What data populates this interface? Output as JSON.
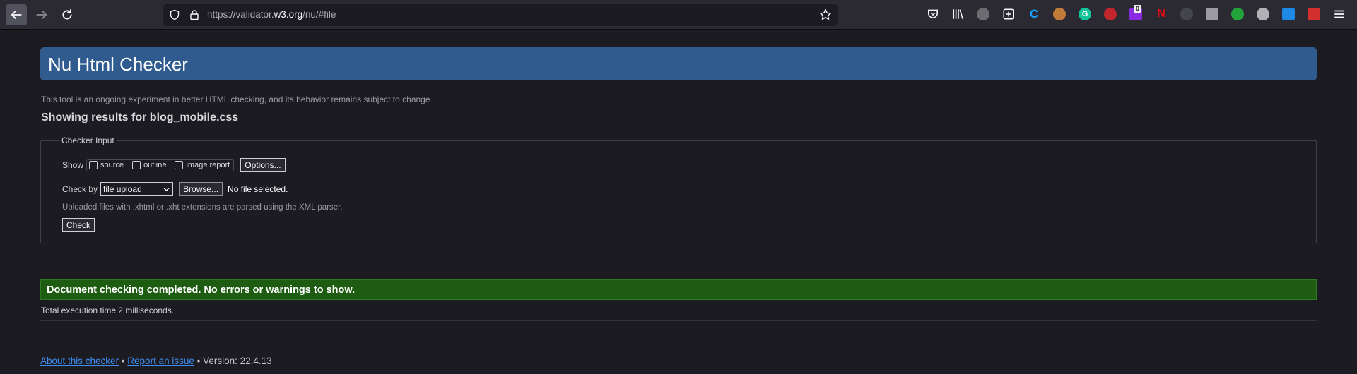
{
  "browser": {
    "url_prefix": "https://validator.",
    "url_host": "w3.org",
    "url_suffix": "/nu/#file",
    "icons": [
      "back-icon",
      "forward-icon",
      "reload-icon",
      "shield-icon",
      "lock-icon",
      "star-icon"
    ],
    "extensions": [
      "pocket-icon",
      "library-icon",
      "extension-icon",
      "extension-icon",
      "extension-icon",
      "extension-icon",
      "grammarly-icon",
      "extension-icon",
      "extension-icon",
      "netflix-icon",
      "extension-icon",
      "extension-icon",
      "extension-icon",
      "extension-icon",
      "extension-icon",
      "extension-icon",
      "menu-icon"
    ],
    "badge_count": "0"
  },
  "page": {
    "title": "Nu Html Checker",
    "notice": "This tool is an ongoing experiment in better HTML checking, and its behavior remains subject to change",
    "results_title": "Showing results for blog_mobile.css"
  },
  "checker": {
    "legend": "Checker Input",
    "show_label": "Show",
    "options": [
      {
        "label": "source",
        "checked": false
      },
      {
        "label": "outline",
        "checked": false
      },
      {
        "label": "image report",
        "checked": false
      }
    ],
    "options_button": "Options...",
    "check_by_label": "Check by",
    "check_by_value": "file upload",
    "browse_button": "Browse...",
    "no_file": "No file selected.",
    "upload_note": "Uploaded files with .xhtml or .xht extensions are parsed using the XML parser.",
    "check_button": "Check"
  },
  "result": {
    "message": "Document checking completed. No errors or warnings to show.",
    "execution_time": "Total execution time 2 milliseconds."
  },
  "footer": {
    "about_link": "About this checker",
    "separator1": " • ",
    "report_link": "Report an issue",
    "version": " • Version: 22.4.13"
  },
  "colors": {
    "header_bg": "#2f5b8f",
    "success_bg": "#1e5c12",
    "link": "#3f8ff3",
    "page_bg": "#1c1b22"
  }
}
